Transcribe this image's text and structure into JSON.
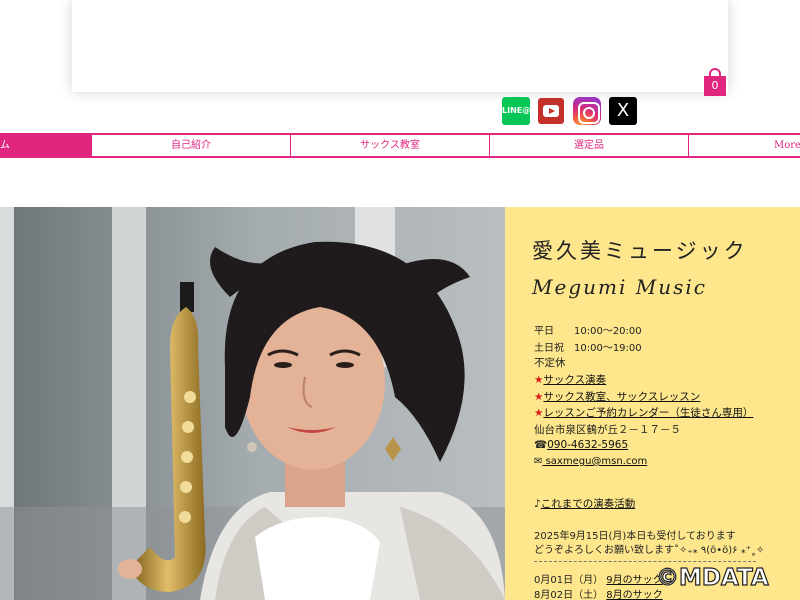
{
  "cart": {
    "count": "0"
  },
  "social": {
    "line": "LINE@",
    "x": "X"
  },
  "nav": [
    {
      "label": "ム"
    },
    {
      "label": "自己紹介"
    },
    {
      "label": "サックス教室"
    },
    {
      "label": "選定品"
    },
    {
      "label": "More"
    }
  ],
  "info": {
    "title": "愛久美ミュージック",
    "subtitle": "Megumi Music",
    "hours": [
      {
        "label": "平日",
        "value": "10:00〜20:00"
      },
      {
        "label": "土日祝",
        "value": "10:00〜19:00"
      }
    ],
    "closed": "不定休",
    "star": "★",
    "links": [
      "サックス演奏",
      "サックス教室、サックスレッスン",
      "レッスンご予約カレンダー（生徒さん専用）"
    ],
    "address": "仙台市泉区鶴が丘２－１７－５",
    "phone_icon": "☎",
    "phone": "090-4632-5965",
    "mail_icon": "✉",
    "email": " saxmegu@msn.com",
    "note_icon": "♪",
    "activity_link": "これまでの演奏活動",
    "notice1": "2025年9月15日(月)本日も受付しております",
    "notice2": "どうぞよろしくお願い致します˚✧₊⁎ ٩(ö•ö)۶ ⁎⁺˳✧",
    "sched1_date": "0月01日（月）",
    "sched1_link": "9月のサック",
    "sched2_date": "8月02日（土）",
    "sched2_link": "8月のサック"
  },
  "watermark": "©MDATA",
  "colors": {
    "accent": "#e0267f",
    "panel": "#fde68c"
  }
}
